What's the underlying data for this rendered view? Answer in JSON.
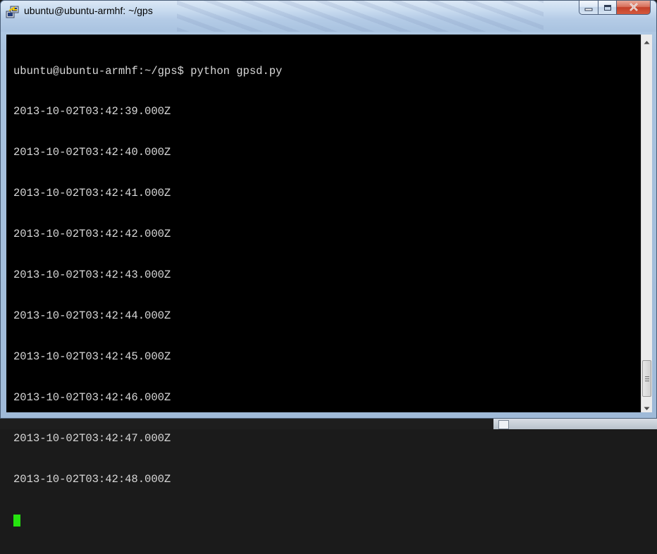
{
  "window": {
    "title": "ubuntu@ubuntu-armhf: ~/gps",
    "controls": {
      "minimize": "minimize",
      "maximize": "maximize",
      "close": "close"
    }
  },
  "terminal": {
    "prompt": "ubuntu@ubuntu-armhf:~/gps$ python gpsd.py",
    "lines": [
      "2013-10-02T03:42:39.000Z",
      "2013-10-02T03:42:40.000Z",
      "2013-10-02T03:42:41.000Z",
      "2013-10-02T03:42:42.000Z",
      "2013-10-02T03:42:43.000Z",
      "2013-10-02T03:42:44.000Z",
      "2013-10-02T03:42:45.000Z",
      "2013-10-02T03:42:46.000Z",
      "2013-10-02T03:42:47.000Z",
      "2013-10-02T03:42:48.000Z"
    ],
    "cursor_color": "#25e30f",
    "scroll_position": 1.0
  },
  "icons": {
    "app": "putty-icon",
    "minimize": "minimize-icon",
    "maximize": "maximize-icon",
    "close": "close-icon",
    "scroll_up": "scroll-up-arrow-icon",
    "scroll_down": "scroll-down-arrow-icon"
  }
}
